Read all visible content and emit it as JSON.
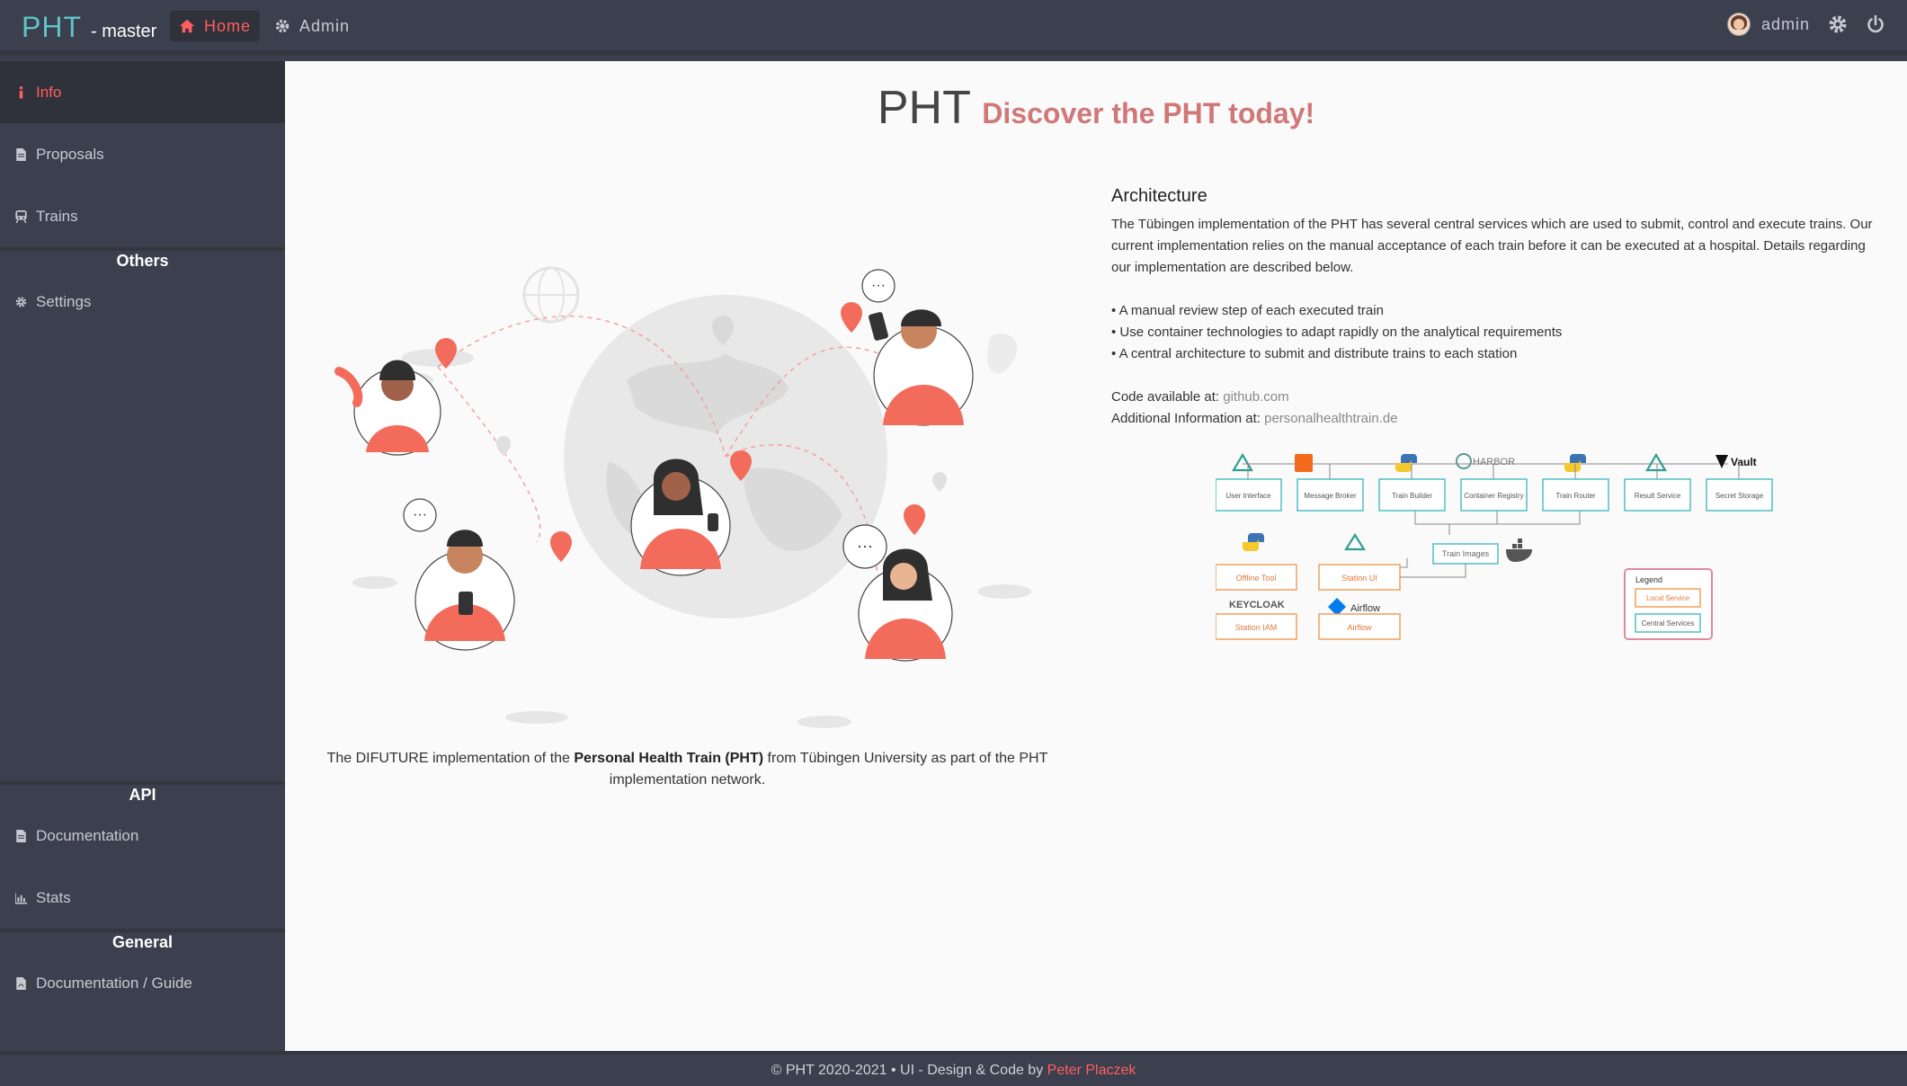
{
  "header": {
    "brand": "PHT",
    "brand_suffix": "- master",
    "nav": [
      {
        "label": "Home",
        "icon": "home-icon",
        "active": true
      },
      {
        "label": "Admin",
        "icon": "gear-icon",
        "active": false
      }
    ],
    "user": "admin"
  },
  "sidebar": {
    "items_top": [
      {
        "label": "Info",
        "icon": "info-icon",
        "active": true
      },
      {
        "label": "Proposals",
        "icon": "file-icon"
      },
      {
        "label": "Trains",
        "icon": "train-icon"
      }
    ],
    "others_heading": "Others",
    "settings_label": "Settings",
    "api_heading": "API",
    "documentation_label": "Documentation",
    "stats_label": "Stats",
    "general_heading": "General",
    "guide_label": "Documentation / Guide"
  },
  "main": {
    "title": "PHT",
    "subtitle": "Discover the PHT today!",
    "intro_pre": "The DIFUTURE implementation of the ",
    "intro_bold": "Personal Health Train (PHT)",
    "intro_post": " from Tübingen University as part of the PHT implementation network.",
    "architecture": {
      "heading": "Architecture",
      "paragraph": "The Tübingen implementation of the PHT has several central services which are used to submit, control and execute trains. Our current implementation relies on the manual acceptance of each train before it can be executed at a hospital. Details regarding our implementation are described below.",
      "bullets": [
        "• A manual review step of each executed train",
        "• Use container technologies to adapt rapidly on the analytical requirements",
        "• A central architecture to submit and distribute trains to each station"
      ],
      "code_label": "Code available at: ",
      "code_link": "github.com",
      "info_label": "Additional Information at: ",
      "info_link": "personalhealthtrain.de"
    },
    "diagram": {
      "central": [
        "User Interface",
        "Message Broker",
        "Train Builder",
        "Container Registry",
        "Train Router",
        "Result Service",
        "Secret Storage"
      ],
      "train_images": "Train Images",
      "local": [
        "Offline Tool",
        "Station UI",
        "Station IAM",
        "Airflow"
      ],
      "logos": [
        "HARBOR",
        "Vault",
        "KEYCLOAK",
        "Airflow"
      ],
      "legend_title": "Legend",
      "legend_local": "Local Service",
      "legend_central": "Central Services"
    }
  },
  "footer": {
    "text": "© PHT 2020-2021 • UI - Design & Code by ",
    "author": "Peter Placzek"
  },
  "colors": {
    "accent": "#ff5f5f",
    "brand": "#5fc3c8",
    "sidebar_bg": "#3c3f4d",
    "central_box": "#4fbfc4",
    "local_box": "#f0a15a"
  }
}
